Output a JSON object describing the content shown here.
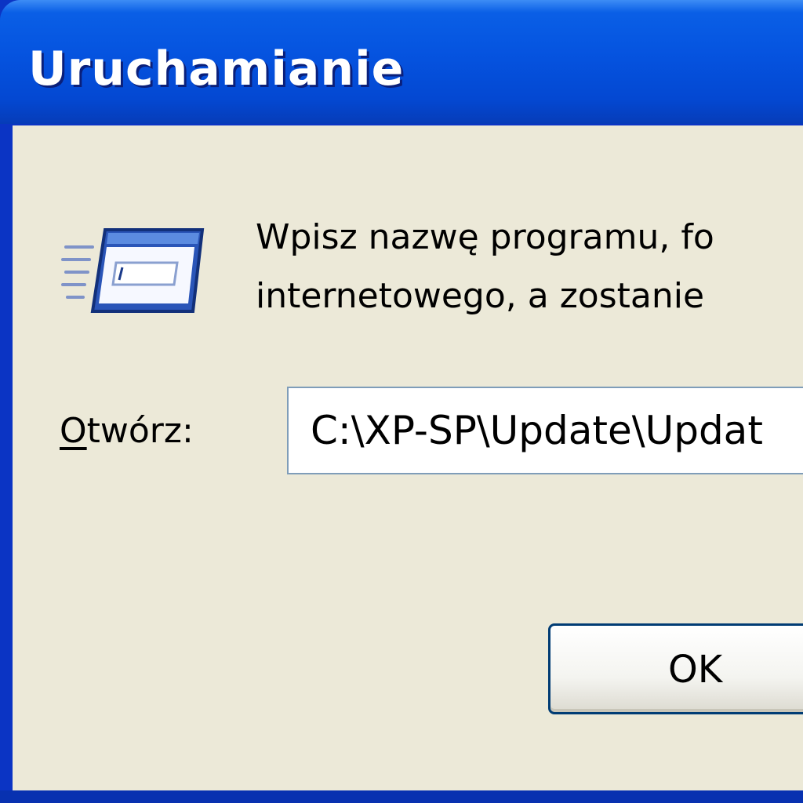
{
  "window": {
    "title": "Uruchamianie"
  },
  "dialog": {
    "icon": "run-dialog-icon",
    "prompt_line_1": "Wpisz nazwę programu, fo",
    "prompt_line_2": "internetowego, a zostanie",
    "open_label_mnemonic": "O",
    "open_label_rest": "twórz:",
    "open_value": "C:\\XP-SP\\Update\\Updat",
    "ok_label": "OK"
  },
  "colors": {
    "titlebar": "#0553df",
    "title_text": "#ffffff",
    "dialog_background": "#ece9d8",
    "input_border": "#7f9db9",
    "button_border": "#003c74"
  }
}
